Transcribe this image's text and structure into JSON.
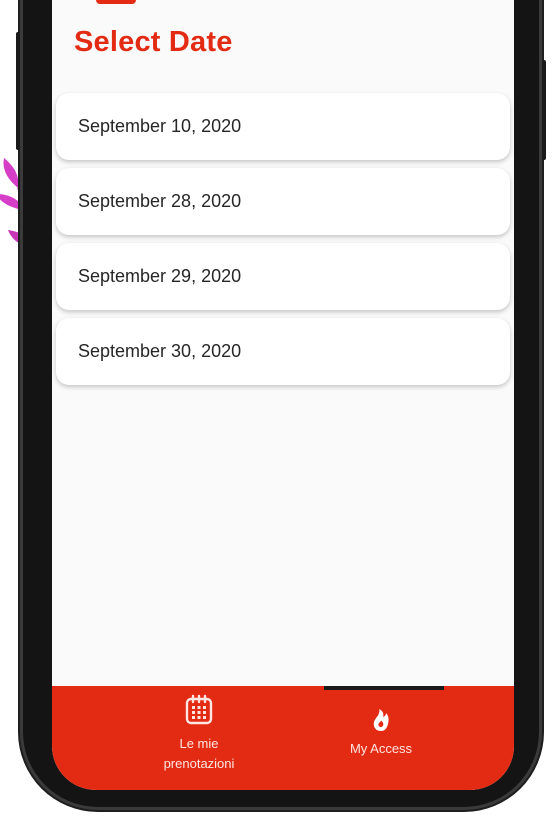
{
  "screen": {
    "title": "Select Date"
  },
  "dates": [
    "September 10, 2020",
    "September 28, 2020",
    "September 29, 2020",
    "September 30, 2020"
  ],
  "bottom_nav": {
    "items": [
      {
        "label": "Le mie\nprenotazioni",
        "icon": "calendar-icon"
      },
      {
        "label": "My Access",
        "icon": "flame-icon"
      }
    ],
    "active": "My Access"
  },
  "colors": {
    "accent": "#e32b14",
    "decoration": "#d63ec8"
  }
}
